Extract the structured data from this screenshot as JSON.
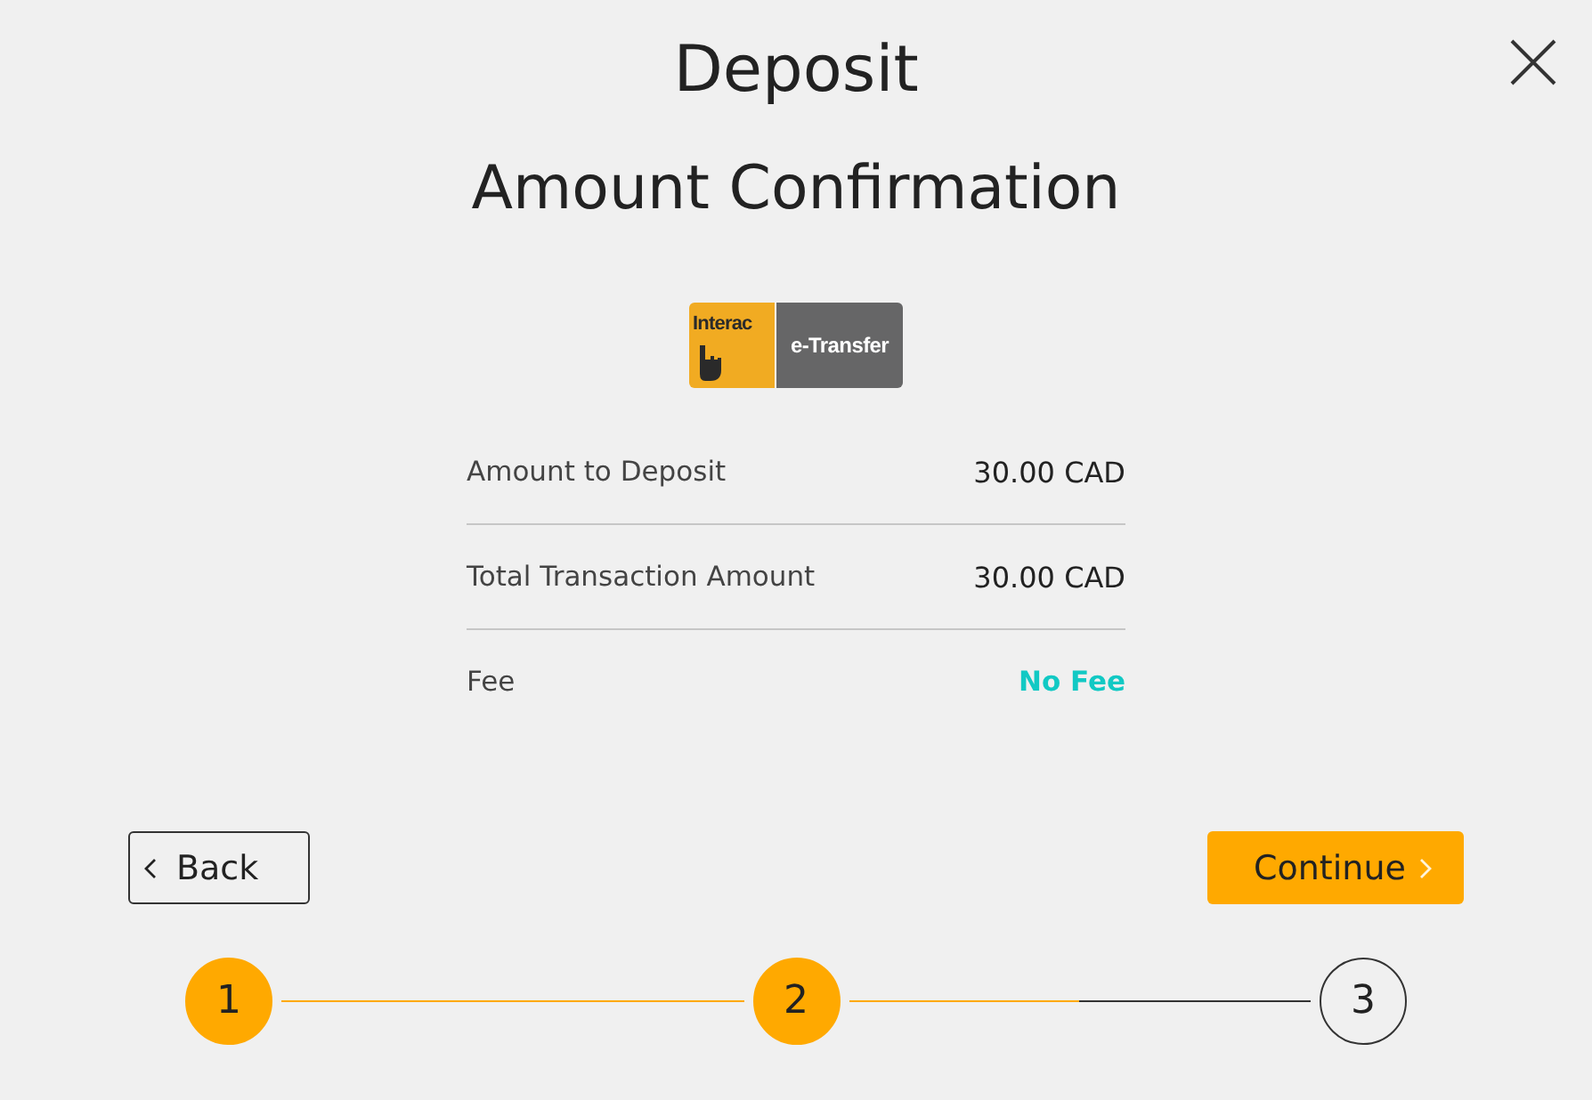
{
  "header": {
    "title": "Deposit",
    "subtitle": "Amount Confirmation"
  },
  "payment_method": {
    "logo_wordmark": "Interac",
    "logo_label": "e-Transfer"
  },
  "summary": {
    "rows": [
      {
        "label": "Amount to Deposit",
        "value": "30.00 CAD",
        "highlighted": false
      },
      {
        "label": "Total Transaction Amount",
        "value": "30.00 CAD",
        "highlighted": false
      },
      {
        "label": "Fee",
        "value": "No Fee",
        "highlighted": true
      }
    ]
  },
  "actions": {
    "back": "Back",
    "continue": "Continue"
  },
  "steps": [
    {
      "label": "1",
      "reached": true
    },
    {
      "label": "2",
      "reached": true
    },
    {
      "label": "3",
      "reached": false
    }
  ],
  "connectors": [
    {
      "level": 1
    },
    {
      "level": 0.5
    }
  ]
}
